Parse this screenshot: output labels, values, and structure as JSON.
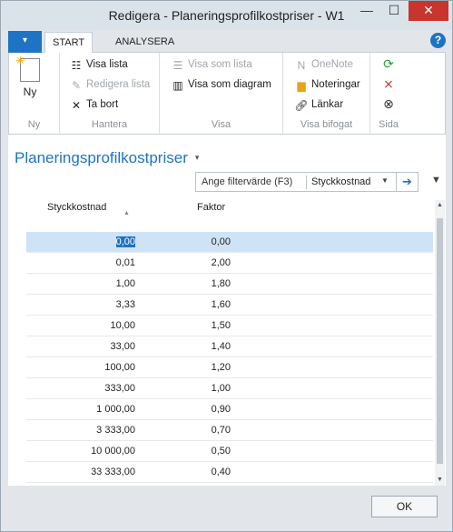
{
  "window": {
    "title": "Redigera - Planeringsprofilkostpriser - W1",
    "min_glyph": "—",
    "max_glyph": "☐",
    "close_glyph": "✕"
  },
  "ribbon": {
    "app_button_glyph": "▾",
    "tabs": [
      {
        "label": "START"
      },
      {
        "label": "ANALYSERA"
      }
    ],
    "help_glyph": "?",
    "groups": {
      "ny": {
        "label": "Ny",
        "new": "Ny"
      },
      "hantera": {
        "label": "Hantera",
        "visa_lista": "Visa lista",
        "redigera_lista": "Redigera lista",
        "ta_bort": "Ta bort"
      },
      "visa": {
        "label": "Visa",
        "visa_som_lista": "Visa som lista",
        "visa_som_diagram": "Visa som diagram"
      },
      "bifogat": {
        "label": "Visa bifogat",
        "onenote": "OneNote",
        "noteringar": "Noteringar",
        "lankar": "Länkar"
      },
      "sida": {
        "label": "Sida"
      }
    }
  },
  "page": {
    "title": "Planeringsprofilkostpriser",
    "title_caret": "▾"
  },
  "filter": {
    "placeholder": "Ange filtervärde (F3)",
    "field": "Styckkostnad",
    "dropdown_glyph": "▼",
    "go_glyph": "➔",
    "expand_glyph": "▼"
  },
  "table": {
    "headers": {
      "col1": "Styckkostnad",
      "col2": "Faktor",
      "sort_glyph": "▲"
    },
    "rows": [
      {
        "cost": "0,00",
        "factor": "0,00"
      },
      {
        "cost": "0,01",
        "factor": "2,00"
      },
      {
        "cost": "1,00",
        "factor": "1,80"
      },
      {
        "cost": "3,33",
        "factor": "1,60"
      },
      {
        "cost": "10,00",
        "factor": "1,50"
      },
      {
        "cost": "33,00",
        "factor": "1,40"
      },
      {
        "cost": "100,00",
        "factor": "1,20"
      },
      {
        "cost": "333,00",
        "factor": "1,00"
      },
      {
        "cost": "1 000,00",
        "factor": "0,90"
      },
      {
        "cost": "3 333,00",
        "factor": "0,70"
      },
      {
        "cost": "10 000,00",
        "factor": "0,50"
      },
      {
        "cost": "33 333,00",
        "factor": "0,40"
      }
    ]
  },
  "scroll": {
    "up_glyph": "▲",
    "down_glyph": "▼"
  },
  "footer": {
    "ok_label": "OK"
  },
  "colors": {
    "accent": "#1e73c3",
    "selection": "#cfe3f6",
    "close": "#c7352c"
  }
}
